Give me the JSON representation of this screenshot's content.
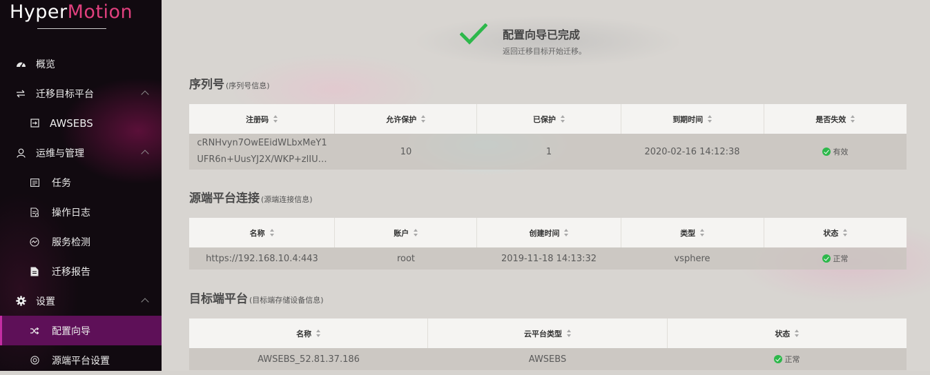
{
  "brand": {
    "name_part1": "Hyper",
    "name_part2": "Motion"
  },
  "sidebar": {
    "items": [
      {
        "label": "概览",
        "icon": "dashboard-icon"
      },
      {
        "label": "迁移目标平台",
        "icon": "transfer-icon",
        "expanded": true
      },
      {
        "label": "AWSEBS",
        "icon": "login-icon"
      },
      {
        "label": "运维与管理",
        "icon": "user-icon",
        "expanded": true
      },
      {
        "label": "任务",
        "icon": "list-icon"
      },
      {
        "label": "操作日志",
        "icon": "log-icon"
      },
      {
        "label": "服务检测",
        "icon": "monitor-icon"
      },
      {
        "label": "迁移报告",
        "icon": "report-icon"
      },
      {
        "label": "设置",
        "icon": "gear-icon",
        "expanded": true
      },
      {
        "label": "配置向导",
        "icon": "shuffle-icon",
        "active": true
      },
      {
        "label": "源端平台设置",
        "icon": "target-icon"
      }
    ]
  },
  "completion": {
    "title": "配置向导已完成",
    "subtitle": "返回迁移目标开始迁移。",
    "check_color": "#2db84b"
  },
  "serial": {
    "title": "序列号",
    "subtitle": "(序列号信息)",
    "columns": [
      "注册码",
      "允许保护",
      "已保护",
      "到期时间",
      "是否失效"
    ],
    "row": {
      "code_line1": "cRNHvyn7OwEEidWLbxMeY1",
      "code_line2": "UFR6n+UusYJ2X/WKP+zlIU…",
      "allowed": "10",
      "protected": "1",
      "expire": "2020-02-16 14:12:38",
      "status": "有效"
    }
  },
  "source": {
    "title": "源端平台连接",
    "subtitle": "(源端连接信息)",
    "columns": [
      "名称",
      "账户",
      "创建时间",
      "类型",
      "状态"
    ],
    "row": {
      "name": "https://192.168.10.4:443",
      "account": "root",
      "created": "2019-11-18 14:13:32",
      "type": "vsphere",
      "status": "正常"
    }
  },
  "target": {
    "title": "目标端平台",
    "subtitle": "(目标端存储设备信息)",
    "columns": [
      "名称",
      "云平台类型",
      "状态"
    ],
    "row": {
      "name": "AWSEBS_52.81.37.186",
      "platform": "AWSEBS",
      "status": "正常"
    }
  },
  "colors": {
    "sidebar_active": "#5e1058",
    "accent": "#c42da3",
    "ok": "#2db84b"
  }
}
